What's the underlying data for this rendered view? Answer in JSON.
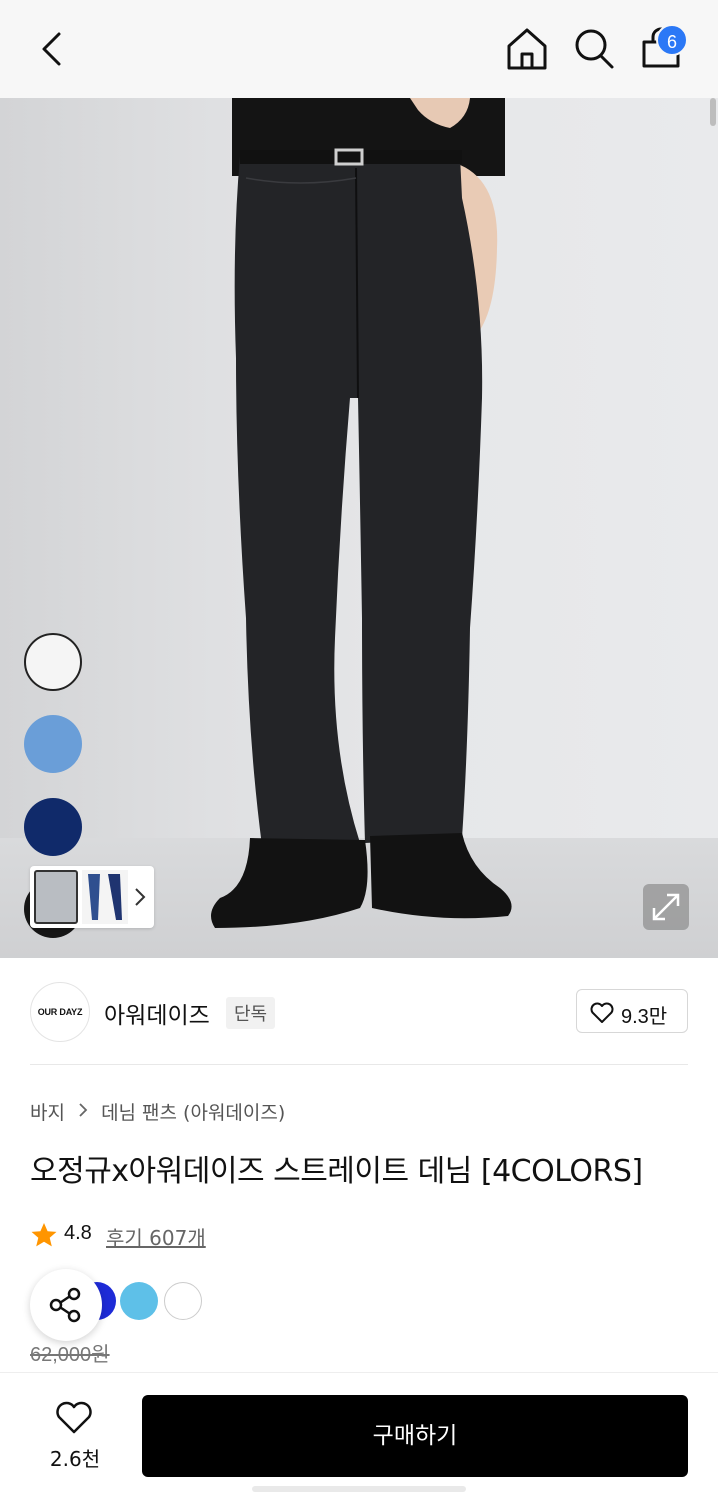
{
  "header": {
    "back_icon": "chevron-left-icon",
    "home_icon": "home-icon",
    "search_icon": "search-icon",
    "cart_icon": "shopping-bag-icon",
    "cart_count": "6"
  },
  "gallery": {
    "color_swatches": [
      "#f5f5f5",
      "#6a9ed8",
      "#102a6a",
      "#161616"
    ],
    "expand_icon": "expand-icon"
  },
  "brand": {
    "logo_text": "OUR DAYZ",
    "name": "아워데이즈",
    "tag": "단독",
    "like_count": "9.3만"
  },
  "breadcrumb": {
    "level1": "바지",
    "level2": "데님 팬츠 (아워데이즈)"
  },
  "product": {
    "title": "오정규x아워데이즈 스트레이트 데님 [4COLORS]",
    "rating": "4.8",
    "reviews": "후기 607개",
    "color_options": [
      "#1e2bd7",
      "#5ec0e8",
      "#ffffff"
    ],
    "original_price": "62,000원"
  },
  "bottom_bar": {
    "wish_count": "2.6천",
    "buy_label": "구매하기"
  },
  "colors": {
    "badge": "#2b78f6",
    "star": "#ff9500",
    "buy_button": "#000000"
  }
}
